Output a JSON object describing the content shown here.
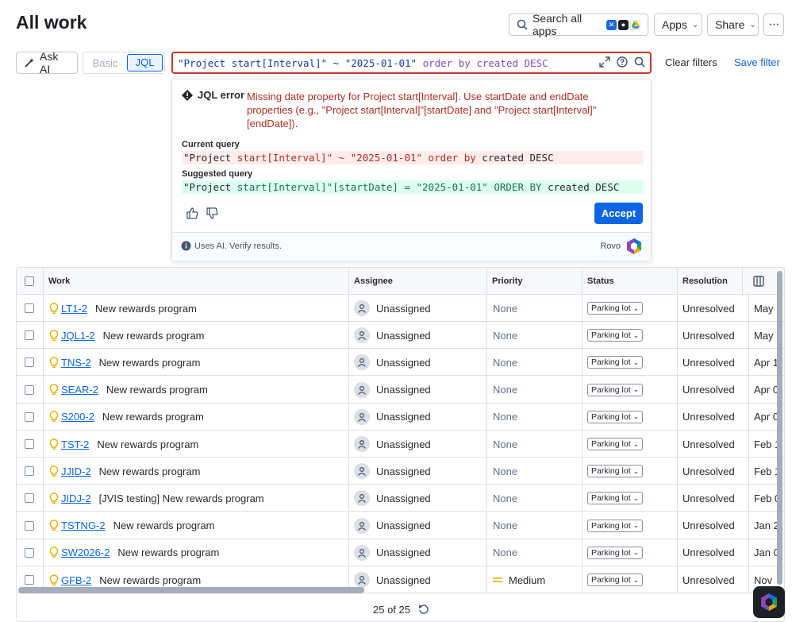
{
  "page": {
    "title": "All work"
  },
  "header": {
    "search_label": "Search all apps",
    "apps_label": "Apps",
    "share_label": "Share",
    "more_icon": "more-icon",
    "app_logo_colors": [
      "#1868db",
      "#1d2125",
      "#34a853"
    ]
  },
  "toolbar": {
    "ask_ai_label": "Ask AI",
    "mode_basic": "Basic",
    "mode_jql": "JQL",
    "query": {
      "field": "\"Project start[Interval]\"",
      "operator": " ~ ",
      "value": "\"2025-01-01\"",
      "order_kw": " order by ",
      "order_field": "created",
      "order_dir": " DESC"
    },
    "clear_filters": "Clear filters",
    "save_filter": "Save filter"
  },
  "error_panel": {
    "title": "JQL error",
    "message": "Missing date property for Project start[Interval]. Use startDate and endDate properties (e.g., \"Project start[Interval]\"[startDate] and \"Project start[Interval]\"[endDate]).",
    "current_label": "Current query",
    "current": {
      "p1": "\"Project ",
      "p2": "start[Interval]\" ~ \"2025-01-01\" order by ",
      "p3": "created DESC"
    },
    "suggested_label": "Suggested query",
    "suggested": {
      "p1": "\"Project ",
      "p2": "start[Interval]\"[startDate] = \"2025-01-01\" ORDER BY ",
      "p3": "created DESC"
    },
    "accept_label": "Accept",
    "footer_note": "Uses AI. Verify results.",
    "brand": "Rovo"
  },
  "table": {
    "columns": [
      "Work",
      "Assignee",
      "Priority",
      "Status",
      "Resolution"
    ],
    "rows": [
      {
        "key": "LT1-2",
        "summary": "New rewards program",
        "assignee": "Unassigned",
        "priority": "None",
        "status": "Parking lot",
        "resolution": "Unresolved",
        "extra": "May"
      },
      {
        "key": "JQL1-2",
        "summary": "New rewards program",
        "assignee": "Unassigned",
        "priority": "None",
        "status": "Parking lot",
        "resolution": "Unresolved",
        "extra": "May"
      },
      {
        "key": "TNS-2",
        "summary": "New rewards program",
        "assignee": "Unassigned",
        "priority": "None",
        "status": "Parking lot",
        "resolution": "Unresolved",
        "extra": "Apr 1"
      },
      {
        "key": "SEAR-2",
        "summary": "New rewards program",
        "assignee": "Unassigned",
        "priority": "None",
        "status": "Parking lot",
        "resolution": "Unresolved",
        "extra": "Apr 0"
      },
      {
        "key": "S200-2",
        "summary": "New rewards program",
        "assignee": "Unassigned",
        "priority": "None",
        "status": "Parking lot",
        "resolution": "Unresolved",
        "extra": "Apr 0"
      },
      {
        "key": "TST-2",
        "summary": "New rewards program",
        "assignee": "Unassigned",
        "priority": "None",
        "status": "Parking lot",
        "resolution": "Unresolved",
        "extra": "Feb 1"
      },
      {
        "key": "JJID-2",
        "summary": "New rewards program",
        "assignee": "Unassigned",
        "priority": "None",
        "status": "Parking lot",
        "resolution": "Unresolved",
        "extra": "Feb 1"
      },
      {
        "key": "JIDJ-2",
        "summary": "[JVIS testing] New rewards program",
        "assignee": "Unassigned",
        "priority": "None",
        "status": "Parking lot",
        "resolution": "Unresolved",
        "extra": "Feb 0"
      },
      {
        "key": "TSTNG-2",
        "summary": "New rewards program",
        "assignee": "Unassigned",
        "priority": "None",
        "status": "Parking lot",
        "resolution": "Unresolved",
        "extra": "Jan 2"
      },
      {
        "key": "SW2026-2",
        "summary": "New rewards program",
        "assignee": "Unassigned",
        "priority": "None",
        "status": "Parking lot",
        "resolution": "Unresolved",
        "extra": "Jan 0"
      },
      {
        "key": "GFB-2",
        "summary": "New rewards program",
        "assignee": "Unassigned",
        "priority": "Medium",
        "status": "Parking lot",
        "resolution": "Unresolved",
        "extra": "Nov"
      }
    ]
  },
  "pagination": {
    "label": "25 of 25"
  },
  "colors": {
    "error": "#ae2e24",
    "link": "#0c66e4",
    "accept": "#0c66e4",
    "priority_medium": "#e2b203"
  }
}
